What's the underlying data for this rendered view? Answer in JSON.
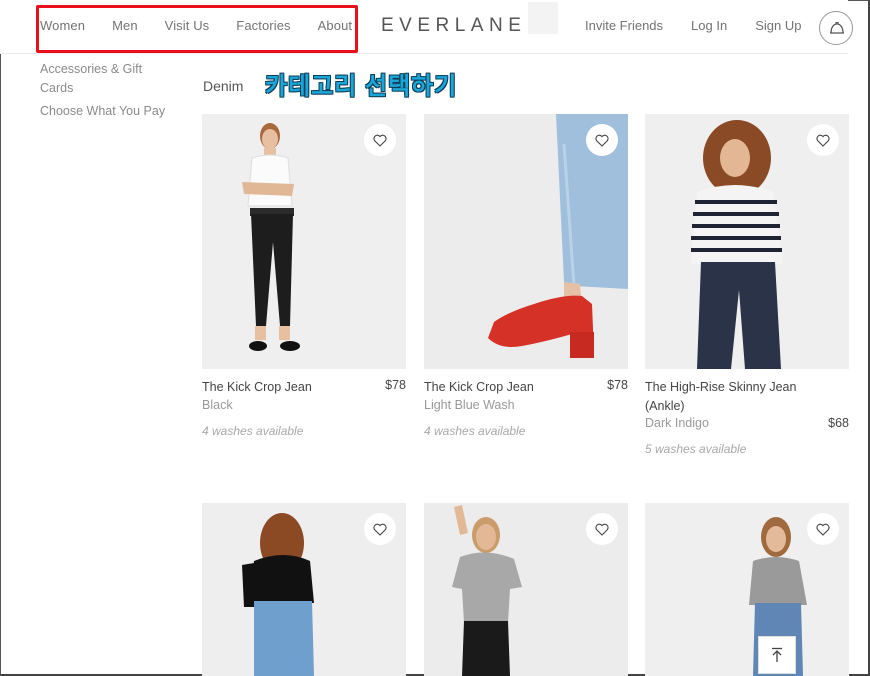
{
  "header": {
    "nav_left": [
      "Women",
      "Men",
      "Visit Us",
      "Factories",
      "About"
    ],
    "logo": "EVERLANE",
    "nav_right": [
      "Invite Friends",
      "Log In",
      "Sign Up"
    ],
    "cart_icon": "cart-icon"
  },
  "sidebar": {
    "items": [
      "Accessories & Gift Cards",
      "Choose What You Pay"
    ]
  },
  "main": {
    "category_title": "Denim",
    "annotation": "카테고리 선택하기",
    "products": [
      {
        "name": "The Kick Crop Jean",
        "price": "$78",
        "color": "Black",
        "washes": "4 washes available"
      },
      {
        "name": "The Kick Crop Jean",
        "price": "$78",
        "color": "Light Blue Wash",
        "washes": "4 washes available"
      },
      {
        "name": "The High-Rise Skinny Jean (Ankle)",
        "price": "$68",
        "color": "Dark Indigo",
        "washes": "5 washes available"
      }
    ]
  },
  "colors": {
    "highlight": "#e8101a",
    "annotation": "#1aa6d8"
  },
  "icons": {
    "heart": "heart-icon",
    "back_to_top": "arrow-up-icon"
  }
}
